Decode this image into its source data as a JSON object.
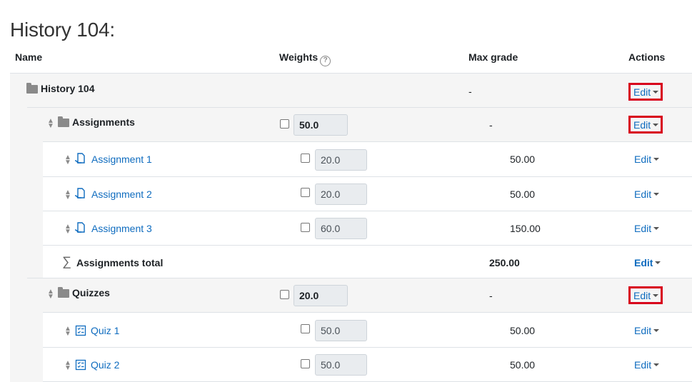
{
  "page_title": "History 104:",
  "columns": {
    "name": "Name",
    "weights": "Weights",
    "max_grade": "Max grade",
    "actions": "Actions"
  },
  "edit_label": "Edit",
  "course": {
    "name": "History 104",
    "max_grade": "-"
  },
  "assignments": {
    "name": "Assignments",
    "weight": "50.0",
    "max_grade": "-",
    "items": [
      {
        "name": "Assignment 1",
        "weight": "20.0",
        "max_grade": "50.00"
      },
      {
        "name": "Assignment 2",
        "weight": "20.0",
        "max_grade": "50.00"
      },
      {
        "name": "Assignment 3",
        "weight": "60.0",
        "max_grade": "150.00"
      }
    ],
    "total": {
      "name": "Assignments total",
      "max_grade": "250.00"
    }
  },
  "quizzes": {
    "name": "Quizzes",
    "weight": "20.0",
    "max_grade": "-",
    "items": [
      {
        "name": "Quiz 1",
        "weight": "50.0",
        "max_grade": "50.00"
      },
      {
        "name": "Quiz 2",
        "weight": "50.0",
        "max_grade": "50.00"
      }
    ]
  },
  "colors": {
    "link": "#0f6cbf",
    "highlight": "#d8001c",
    "band": "#f5f5f5"
  },
  "icons": [
    "help-icon",
    "folder-icon",
    "move-icon",
    "assignment-icon",
    "quiz-icon",
    "sigma-icon",
    "caret-down-icon"
  ]
}
